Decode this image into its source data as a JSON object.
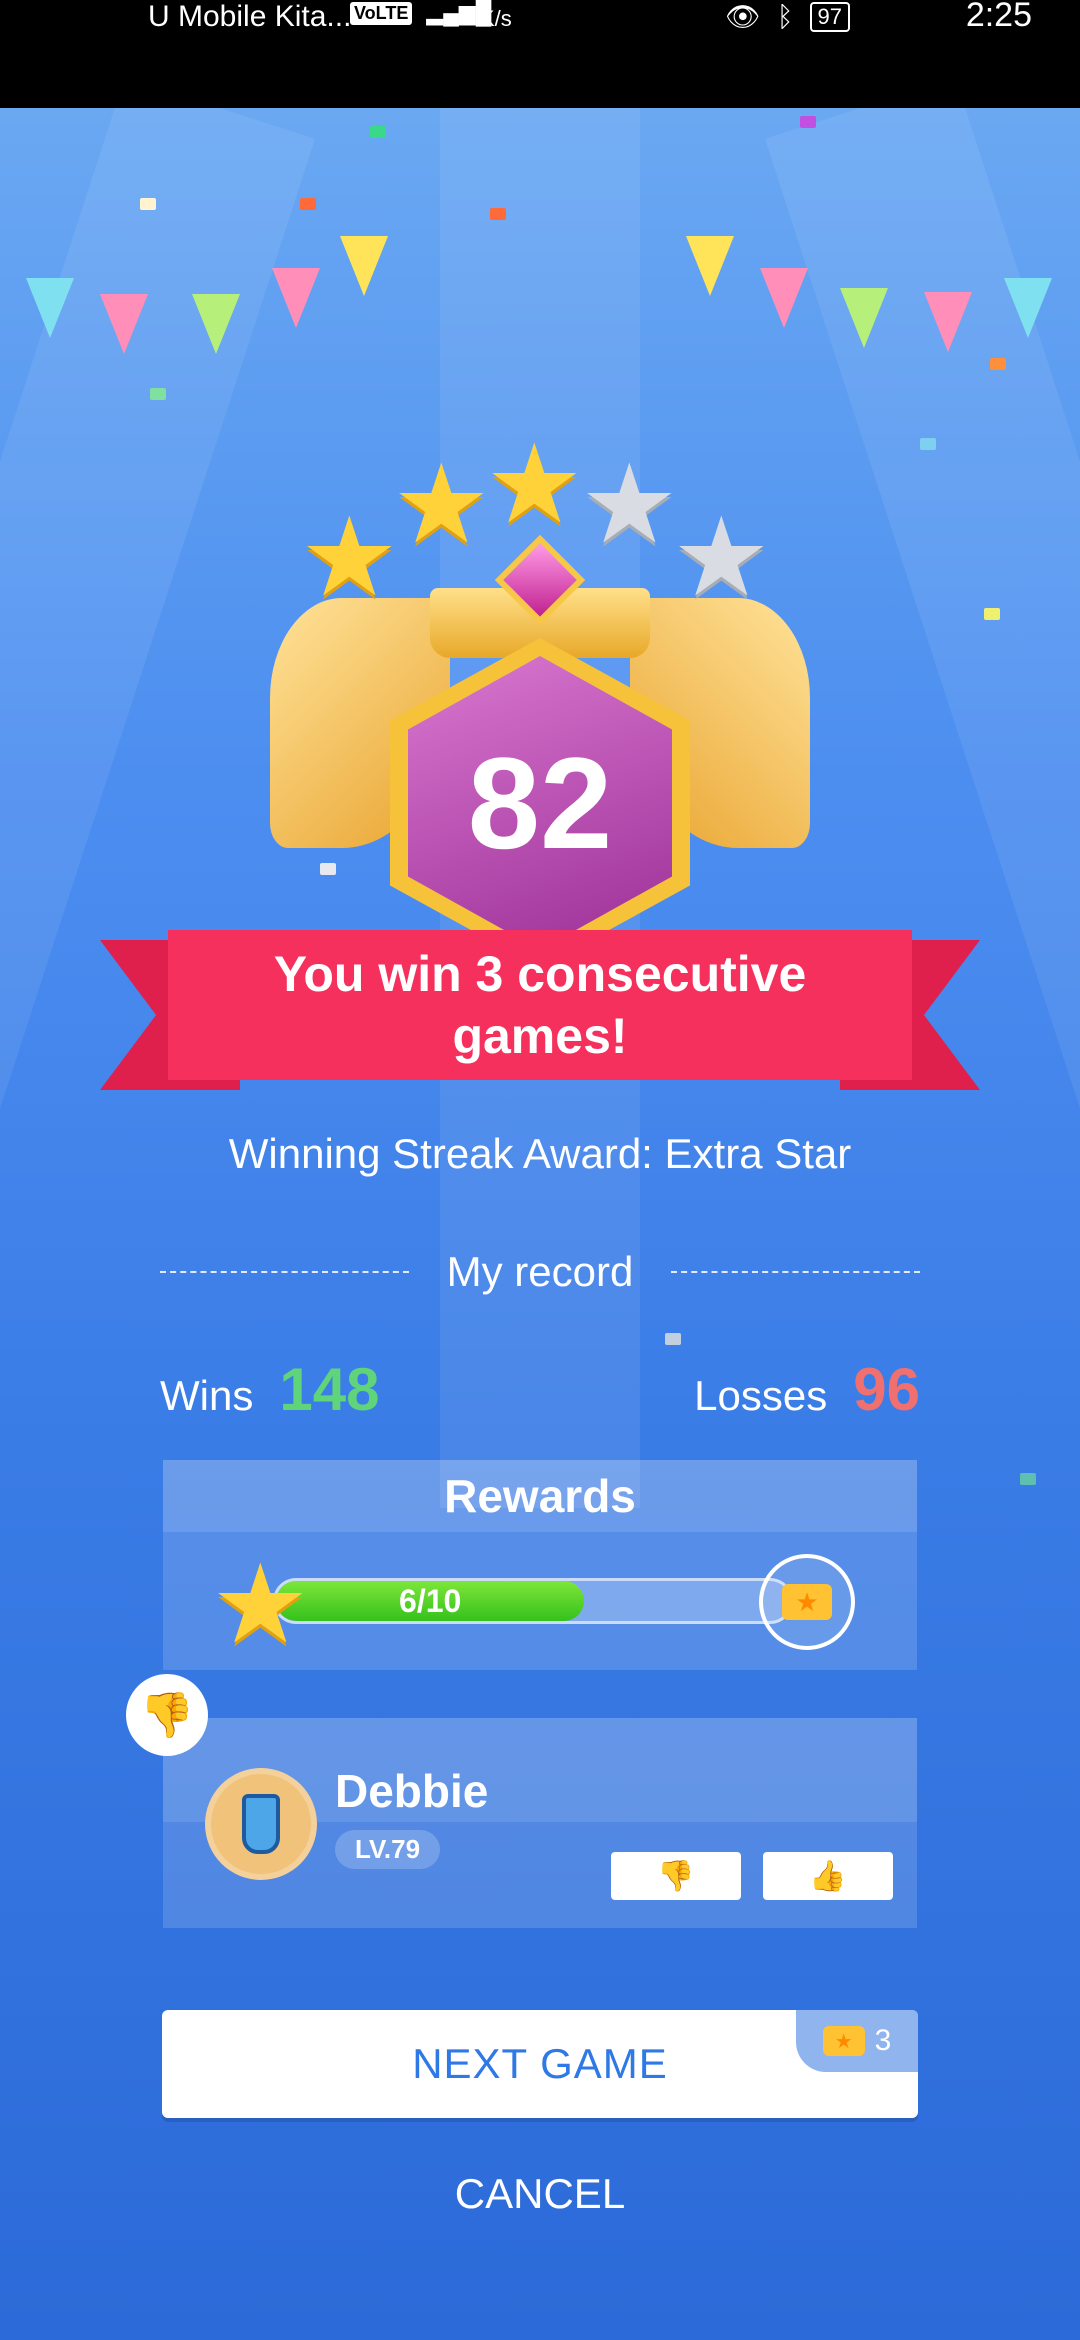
{
  "status_bar": {
    "carrier": "U Mobile Kita...",
    "volte": "VoLTE",
    "signal": "4G",
    "speed": "K/s",
    "battery": "97",
    "time": "2:25"
  },
  "badge": {
    "level": "82",
    "stars_gold": 3,
    "stars_total": 5
  },
  "banner": {
    "line1": "You win 3 consecutive",
    "line2": "games!"
  },
  "award_text": "Winning Streak Award: Extra Star",
  "record": {
    "title": "My record",
    "wins_label": "Wins",
    "wins_value": "148",
    "losses_label": "Losses",
    "losses_value": "96"
  },
  "rewards": {
    "title": "Rewards",
    "progress_text": "6/10",
    "progress_fraction": 0.6
  },
  "player": {
    "name": "Debbie",
    "level": "LV.79"
  },
  "actions": {
    "next_game": "NEXT GAME",
    "ticket_count": "3",
    "cancel": "CANCEL"
  },
  "colors": {
    "accent_blue": "#2f79e6",
    "banner_red": "#f5305c",
    "wins_green": "#5fd47a",
    "losses_red": "#f07070",
    "progress_green": "#35c11c"
  }
}
